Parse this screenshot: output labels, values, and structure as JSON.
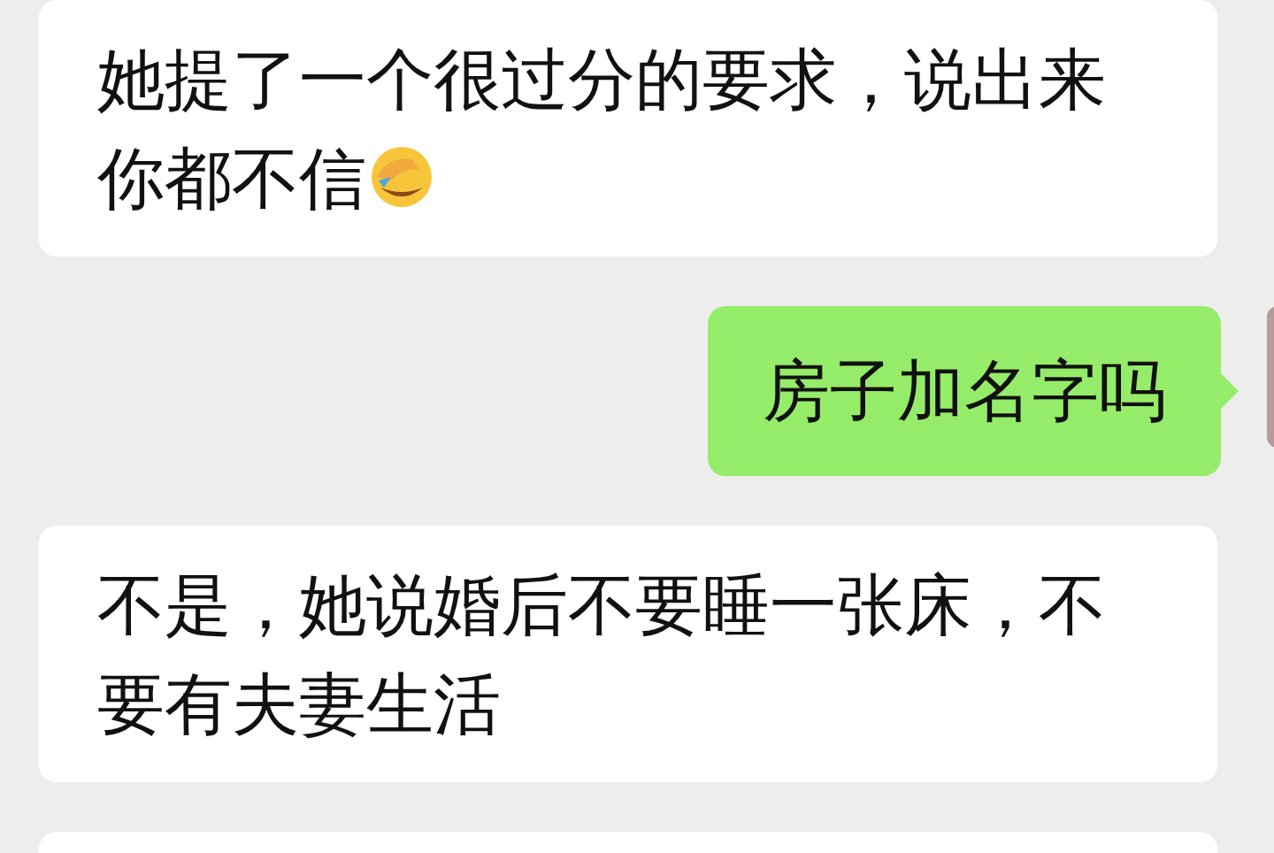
{
  "messages": [
    {
      "kind": "received",
      "text": "她提了一个很过分的要求，说出来你都不信",
      "trailing_emoji": true
    },
    {
      "kind": "sent",
      "text": "房子加名字吗"
    },
    {
      "kind": "received",
      "text": "不是，她说婚后不要睡一张床，不要有夫妻生活"
    },
    {
      "kind": "received"
    }
  ]
}
